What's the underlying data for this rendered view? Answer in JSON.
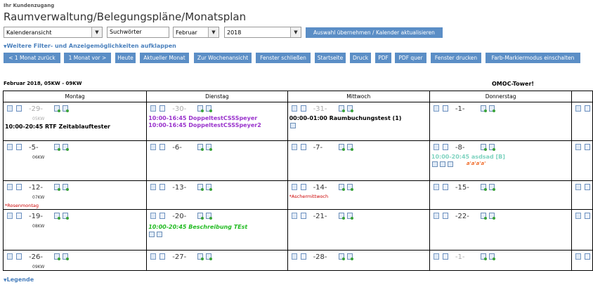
{
  "header": {
    "kundenzugang": "Ihr Kundenzugang",
    "title": "Raumverwaltung/Belegungspläne/Monatsplan"
  },
  "filters": {
    "view": "Kalenderansicht",
    "search_value": "Suchwörter",
    "month": "Februar",
    "year": "2018",
    "empty_select": "",
    "apply_label": "Auswahl übernehmen / Kalender aktualisieren"
  },
  "links": {
    "more_filters": "Weitere Filter- und Anzeigemöglichkeiten aufklappen",
    "legend": "Legende"
  },
  "toolbar": [
    "< 1 Monat zurück",
    "1 Monat vor >",
    "Heute",
    "Aktueller Monat",
    "Zur Wochenansicht",
    "Fenster schließen",
    "Startseite",
    "Druck",
    "PDF",
    "PDF quer",
    "Fenster drucken",
    "Farb-Markiermodus einschalten"
  ],
  "calendar": {
    "range_label": "Februar 2018, 05KW - 09KW",
    "room": "OMOC-Tower!",
    "weekdays": [
      "Montag",
      "Dienstag",
      "Mittwoch",
      "Donnerstag"
    ],
    "rows": [
      {
        "kw": "05KW",
        "days": [
          {
            "num": "-29-",
            "grey": true,
            "events": [
              {
                "text": "10:00-20:45 RTF Zeitablauftester",
                "color": "#000000",
                "italic": false
              }
            ]
          },
          {
            "num": "-30-",
            "grey": true,
            "events": [
              {
                "text": "10:00-16:45 DoppeltestCSSSpeyer",
                "color": "#9932cc",
                "italic": false
              },
              {
                "text": "10:00-16:45 DoppeltestCSSSpeyer2",
                "color": "#9932cc",
                "italic": false
              }
            ]
          },
          {
            "num": "-31-",
            "grey": true,
            "events": [
              {
                "text": "00:00-01:00 Raumbuchungstest (1)",
                "color": "#000000",
                "italic": false
              }
            ],
            "badges": [
              "A"
            ]
          },
          {
            "num": "-1-",
            "grey": false,
            "events": []
          }
        ]
      },
      {
        "kw": "06KW",
        "days": [
          {
            "num": "-5-",
            "grey": false,
            "events": []
          },
          {
            "num": "-6-",
            "grey": false,
            "events": []
          },
          {
            "num": "-7-",
            "grey": false,
            "events": []
          },
          {
            "num": "-8-",
            "grey": false,
            "events": [
              {
                "text": "10:00-20:45 asdsad [B]",
                "color": "#7fd3c0",
                "italic": false
              }
            ],
            "badges": [
              "A",
              "HR",
              "A"
            ],
            "tags": "a'a'a'a'"
          }
        ]
      },
      {
        "kw": "07KW",
        "days": [
          {
            "num": "-12-",
            "grey": false,
            "events": [],
            "holiday": "*Rosenmontag"
          },
          {
            "num": "-13-",
            "grey": false,
            "events": []
          },
          {
            "num": "-14-",
            "grey": false,
            "events": [],
            "holiday": "*Aschermittwoch"
          },
          {
            "num": "-15-",
            "grey": false,
            "events": []
          }
        ]
      },
      {
        "kw": "08KW",
        "days": [
          {
            "num": "-19-",
            "grey": false,
            "events": []
          },
          {
            "num": "-20-",
            "grey": false,
            "events": [
              {
                "text": "10:00-20:45 Beschreibung TEst",
                "color": "#22bb22",
                "italic": true
              }
            ],
            "badges": [
              "A",
              "AB"
            ]
          },
          {
            "num": "-21-",
            "grey": false,
            "events": []
          },
          {
            "num": "-22-",
            "grey": false,
            "events": []
          }
        ]
      },
      {
        "kw": "09KW",
        "days": [
          {
            "num": "-26-",
            "grey": false,
            "events": []
          },
          {
            "num": "-27-",
            "grey": false,
            "events": []
          },
          {
            "num": "-28-",
            "grey": false,
            "events": []
          },
          {
            "num": "-1-",
            "grey": true,
            "events": []
          }
        ]
      }
    ]
  }
}
